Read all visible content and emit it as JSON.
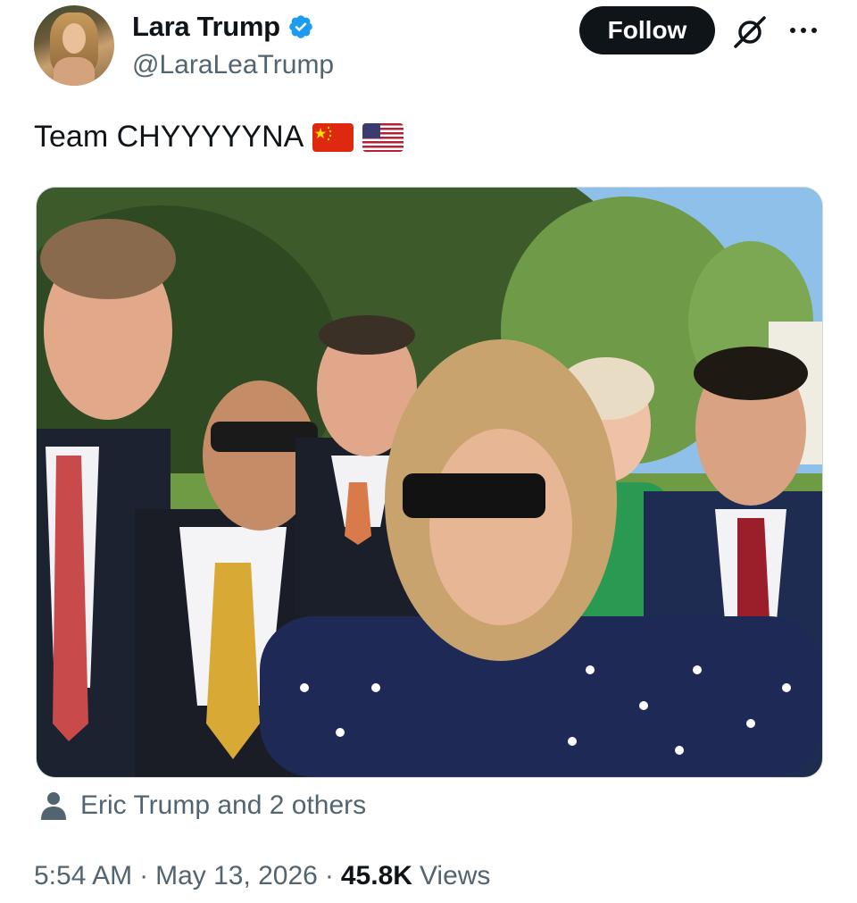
{
  "author": {
    "display_name": "Lara Trump",
    "handle": "@LaraLeaTrump",
    "verified": true,
    "verified_color": "#1d9bf0"
  },
  "header": {
    "follow_label": "Follow",
    "grok_icon": "grok-icon",
    "more_icon": "more-horizontal-icon"
  },
  "tweet": {
    "text": "Team CHYYYYYNA",
    "emoji_flags": [
      "china-flag",
      "usa-flag"
    ]
  },
  "media": {
    "alt_icon": "photo"
  },
  "tags": {
    "label": "Eric Trump and 2 others",
    "icon": "person-icon"
  },
  "meta": {
    "time": "5:54 AM",
    "date": "May 13, 2026",
    "views_count": "45.8K",
    "views_label": "Views"
  },
  "colors": {
    "text_primary": "#0f1419",
    "text_secondary": "#536471",
    "follow_bg": "#0f1419"
  }
}
